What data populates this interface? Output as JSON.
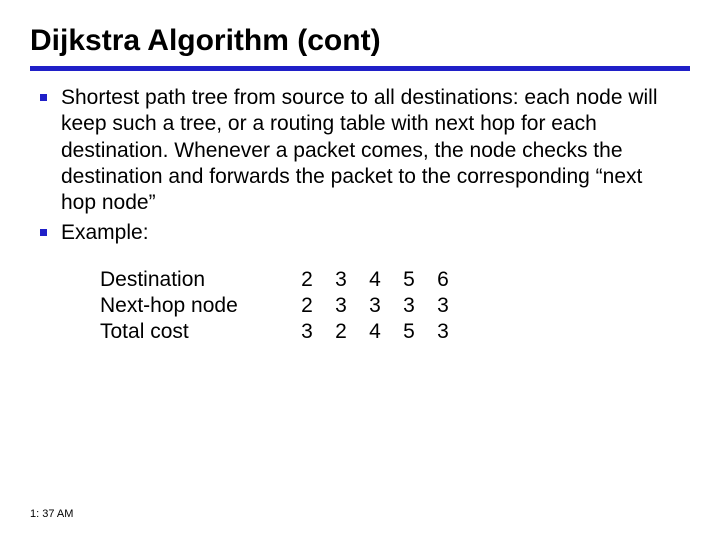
{
  "title": "Dijkstra Algorithm (cont)",
  "bullets": [
    "Shortest path tree from source to all destinations: each node will keep such a tree, or a routing table with next hop for each destination. Whenever a packet comes, the node checks the destination and forwards the packet to the corresponding “next hop node”",
    "Example:"
  ],
  "table": {
    "row_labels": [
      "Destination",
      "Next-hop node",
      "Total cost"
    ],
    "columns": [
      "2",
      "3",
      "4",
      "5",
      "6"
    ],
    "rows": [
      [
        "2",
        "3",
        "4",
        "5",
        "6"
      ],
      [
        "2",
        "3",
        "3",
        "3",
        "3"
      ],
      [
        "3",
        "2",
        "4",
        "5",
        "3"
      ]
    ]
  },
  "footer_time": "1: 37 AM"
}
